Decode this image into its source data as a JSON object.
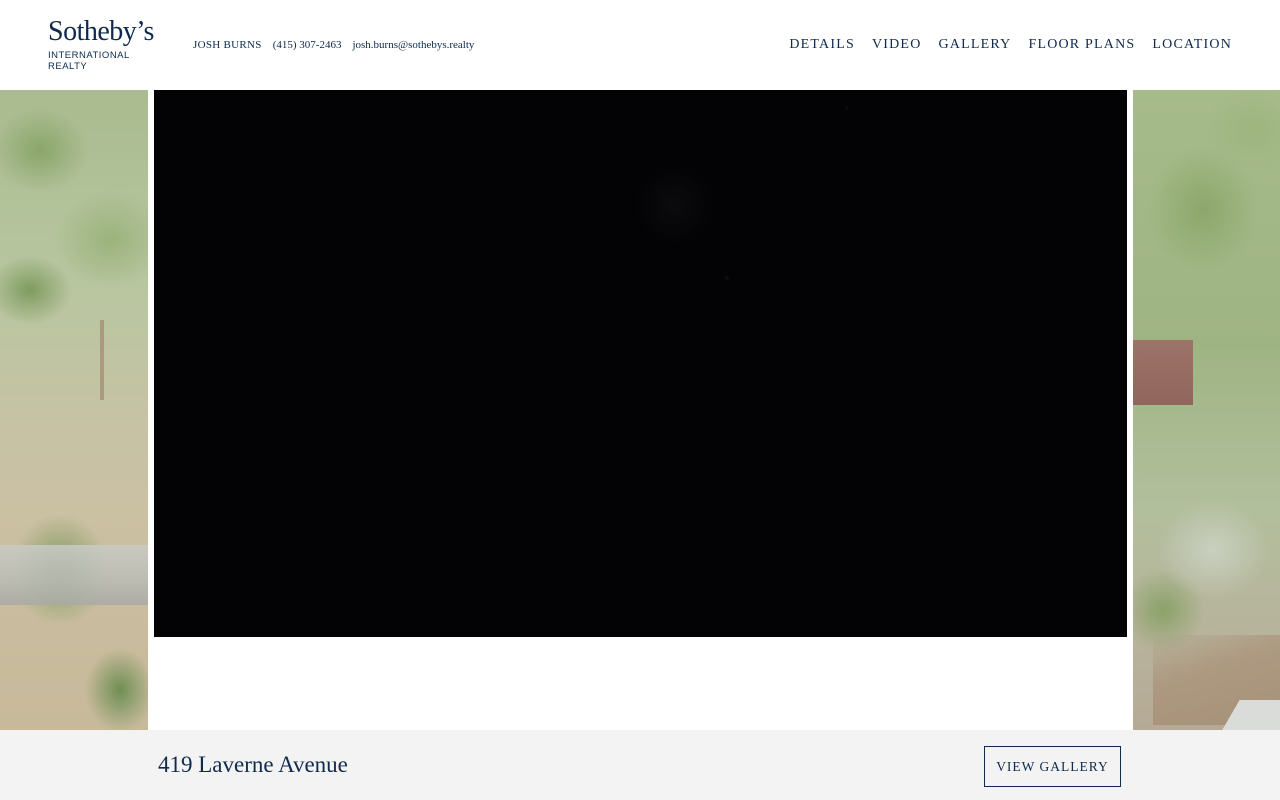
{
  "header": {
    "logo": {
      "main": "Sotheby’s",
      "sub": "INTERNATIONAL REALTY"
    },
    "agent": {
      "name": "JOSH BURNS",
      "phone": "(415) 307-2463",
      "email": "josh.burns@sothebys.realty"
    },
    "nav": [
      {
        "label": "DETAILS"
      },
      {
        "label": "VIDEO"
      },
      {
        "label": "GALLERY"
      },
      {
        "label": "FLOOR PLANS"
      },
      {
        "label": "LOCATION"
      }
    ]
  },
  "video": {
    "state": "black frame"
  },
  "footer": {
    "address": "419 Laverne Avenue",
    "gallery_button": "VIEW GALLERY"
  },
  "colors": {
    "brand": "#0e2a4d",
    "bar": "#f3f3f3",
    "video_bg": "#030306"
  }
}
